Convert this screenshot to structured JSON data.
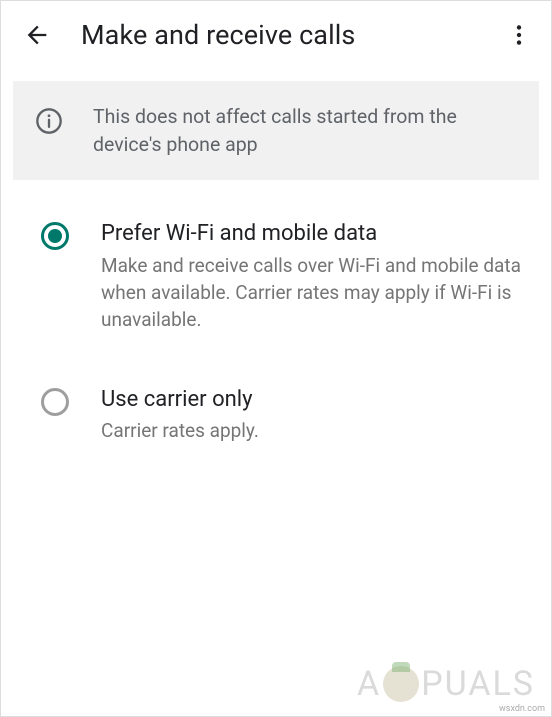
{
  "header": {
    "title": "Make and receive calls"
  },
  "banner": {
    "text": "This does not affect calls started from the device's phone app"
  },
  "options": [
    {
      "title": "Prefer Wi-Fi and mobile data",
      "description": "Make and receive calls over Wi-Fi and mobile data when available. Carrier rates may apply if Wi-Fi is unavailable.",
      "selected": true
    },
    {
      "title": "Use carrier only",
      "description": "Carrier rates apply.",
      "selected": false
    }
  ],
  "watermark": {
    "prefix": "A",
    "suffix": "PUALS",
    "source": "wsxdn.com"
  }
}
